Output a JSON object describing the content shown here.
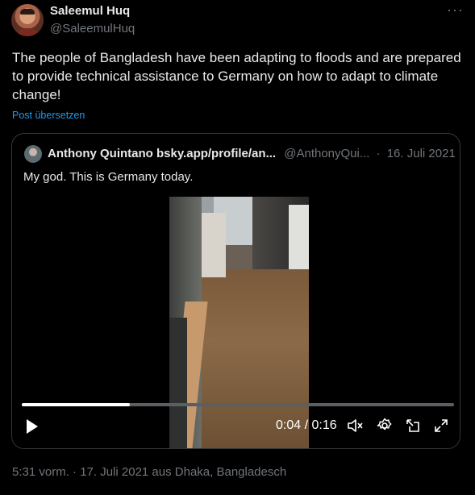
{
  "author": {
    "name": "Saleemul Huq",
    "handle": "@SaleemulHuq"
  },
  "tweet": {
    "text": "The people of Bangladesh have been adapting to floods and are prepared to provide technical assistance to Germany on how to adapt to climate change!",
    "translate_label": "Post übersetzen"
  },
  "more_menu_label": "···",
  "quote": {
    "name": "Anthony Quintano bsky.app/profile/an...",
    "handle": "@AnthonyQui...",
    "separator": "·",
    "date": "16. Juli 2021",
    "text": "My god. This is Germany today."
  },
  "video": {
    "time_display": "0:04 / 0:16",
    "progress": 0.25,
    "controls": [
      "play-icon",
      "mute-icon",
      "settings-icon",
      "popout-icon",
      "fullscreen-icon"
    ]
  },
  "timestamp": "5:31 vorm. · 17. Juli 2021 aus Dhaka, Bangladesch",
  "colors": {
    "background": "#000000",
    "text": "#e7e9ea",
    "secondary": "#71767b",
    "link": "#1d9bf0",
    "border": "#333639"
  }
}
